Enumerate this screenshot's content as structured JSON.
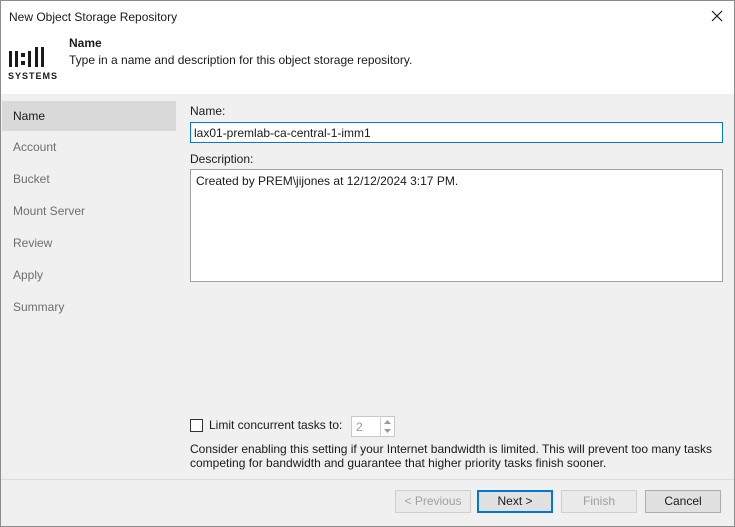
{
  "window": {
    "title": "New Object Storage Repository"
  },
  "header": {
    "step_title": "Name",
    "step_description": "Type in a name and description for this object storage repository.",
    "logo_text": "SYSTEMS"
  },
  "sidebar": {
    "items": [
      {
        "label": "Name",
        "active": true
      },
      {
        "label": "Account",
        "active": false
      },
      {
        "label": "Bucket",
        "active": false
      },
      {
        "label": "Mount Server",
        "active": false
      },
      {
        "label": "Review",
        "active": false
      },
      {
        "label": "Apply",
        "active": false
      },
      {
        "label": "Summary",
        "active": false
      }
    ]
  },
  "form": {
    "name_label": "Name:",
    "name_value": "lax01-premlab-ca-central-1-imm1",
    "description_label": "Description:",
    "description_value": "Created by PREM\\jijones at 12/12/2024 3:17 PM.",
    "limit_label": "Limit concurrent tasks to:",
    "limit_checked": false,
    "limit_value": "2",
    "hint": "Consider enabling this setting if your Internet bandwidth is limited. This will prevent too many tasks competing for bandwidth and guarantee that higher priority tasks finish sooner."
  },
  "buttons": {
    "previous": "< Previous",
    "next": "Next >",
    "finish": "Finish",
    "cancel": "Cancel"
  },
  "icons": {
    "close": "close-icon",
    "up": "chevron-up-icon",
    "down": "chevron-down-icon"
  },
  "colors": {
    "accent": "#0078d7",
    "selected_nav": "#d9d9d9",
    "background": "#f0f0f0"
  }
}
